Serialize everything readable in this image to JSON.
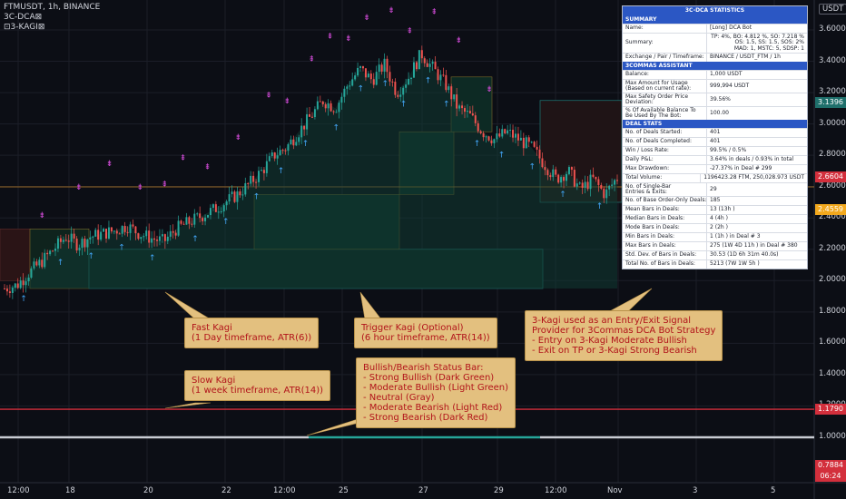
{
  "header": {
    "symbol_line": "FTMUSDT, 1h, BINANCE",
    "indicator1": "3C-DCA⊠",
    "indicator2": "⊡3-KAGI⊠",
    "currency": "USDT"
  },
  "stats_table": {
    "title": "3C-DCA  STATISTICS",
    "sections": [
      {
        "name": "SUMMARY",
        "rows": [
          {
            "k": "Name:",
            "v": "[Long] DCA Bot"
          },
          {
            "k": "Summary:",
            "v": "TP: 4%, BO: 4.812 %, SO: 7.218 %\nOS: 1.5, SS: 1.5, SOS: 2%\nMAD: 1, MSTC: 5, SDSP: 1",
            "right": true
          },
          {
            "k": "Exchange / Pair / Timeframe:",
            "v": "BINANCE / USDT_FTM / 1h"
          }
        ]
      },
      {
        "name": "3COMMAS ASSISTANT",
        "rows": [
          {
            "k": "Balance:",
            "v": "1,000 USDT"
          },
          {
            "k": "Max Amount for Usage\n(Based on current rate):",
            "v": "999,994 USDT"
          },
          {
            "k": "Max Safety Order Price\nDeviation:",
            "v": "39.56%"
          },
          {
            "k": "% Of Available Balance To\nBe Used By The Bot:",
            "v": "100.00"
          }
        ]
      },
      {
        "name": "DEAL STATS",
        "rows": [
          {
            "k": "No. of Deals Started:",
            "v": "401"
          },
          {
            "k": "No. of Deals Completed:",
            "v": "401"
          },
          {
            "k": "Win / Loss Rate:",
            "v": "99.5% / 0.5%"
          },
          {
            "k": "Daily P&L:",
            "v": "3.64% in deals / 0.93% in total"
          },
          {
            "k": "Max Drawdown:",
            "v": "-27.37% in Deal # 299"
          },
          {
            "k": "Total Volume:",
            "v": "1196423.28 FTM, 250,028.973 USDT"
          },
          {
            "k": "No. of Single-Bar\nEntries & Exits:",
            "v": "29"
          },
          {
            "k": "No. of Base Order-Only Deals:",
            "v": "185"
          },
          {
            "k": "Mean Bars in Deals:",
            "v": "13 (13h )"
          },
          {
            "k": "Median Bars in Deals:",
            "v": "4 (4h )"
          },
          {
            "k": "Mode Bars in Deals:",
            "v": "2 (2h )"
          },
          {
            "k": "Min Bars in Deals:",
            "v": "1 (1h ) in Deal # 3"
          },
          {
            "k": "Max Bars in Deals:",
            "v": "275 (1W 4D 11h ) in Deal # 380"
          },
          {
            "k": "Std. Dev. of Bars in Deals:",
            "v": "30.53 (1D 6h 31m 40.0s)"
          },
          {
            "k": "Total No. of Bars in Deals:",
            "v": "5213 (7W 1W 5h )"
          }
        ]
      }
    ]
  },
  "callouts": {
    "fast": "Fast Kagi\n(1 Day timeframe, ATR(6))",
    "trigger": "Trigger Kagi (Optional)\n(6 hour timeframe, ATR(14))",
    "strategy": "3-Kagi used as an Entry/Exit Signal\nProvider for 3Commas DCA Bot Strategy\n- Entry on 3-Kagi Moderate Bullish\n- Exit on TP or 3-Kagi Strong Bearish",
    "slow": "Slow Kagi\n(1 week timeframe, ATR(14))",
    "status": "Bullish/Bearish Status Bar:\n- Strong Bullish (Dark Green)\n- Moderate Bullish (Light Green)\n- Neutral (Gray)\n- Moderate Bearish (Light Red)\n- Strong Bearish (Dark Red)"
  },
  "price_tags": [
    {
      "label": "3.1396",
      "color": "#1f6f6b",
      "value": 3.1396
    },
    {
      "label": "2.6604",
      "color": "#d32f3c",
      "value": 2.6604
    },
    {
      "label": "2.4559",
      "color": "#f2a81d",
      "value": 2.4559
    },
    {
      "label": "1.1790",
      "color": "#d32f3c",
      "value": 1.179
    },
    {
      "label": "0.7884",
      "color": "#d32f3c",
      "value": 0.7884
    }
  ],
  "bottom_time": "06:24",
  "chart_data": {
    "type": "candlestick",
    "title": "FTMUSDT, 1h, BINANCE",
    "yaxis": {
      "ticks": [
        "3.6000",
        "3.4000",
        "3.2000",
        "3.0000",
        "2.8000",
        "2.6000",
        "2.4000",
        "2.2000",
        "2.0000",
        "1.8000",
        "1.6000",
        "1.4000",
        "1.2000",
        "1.0000"
      ],
      "ylim": [
        0.8,
        3.7
      ]
    },
    "xaxis": {
      "ticks": [
        "12:00",
        "18",
        "20",
        "22",
        "12:00",
        "25",
        "27",
        "29",
        "12:00",
        "Nov",
        "3",
        "5"
      ]
    },
    "close_path": [
      [
        0,
        1.95
      ],
      [
        0.02,
        1.97
      ],
      [
        0.04,
        2.05
      ],
      [
        0.06,
        2.12
      ],
      [
        0.08,
        2.2
      ],
      [
        0.1,
        2.28
      ],
      [
        0.12,
        2.23
      ],
      [
        0.14,
        2.28
      ],
      [
        0.16,
        2.3
      ],
      [
        0.18,
        2.32
      ],
      [
        0.2,
        2.35
      ],
      [
        0.22,
        2.3
      ],
      [
        0.24,
        2.27
      ],
      [
        0.26,
        2.25
      ],
      [
        0.28,
        2.33
      ],
      [
        0.3,
        2.37
      ],
      [
        0.32,
        2.41
      ],
      [
        0.34,
        2.45
      ],
      [
        0.36,
        2.5
      ],
      [
        0.38,
        2.55
      ],
      [
        0.4,
        2.62
      ],
      [
        0.42,
        2.7
      ],
      [
        0.44,
        2.8
      ],
      [
        0.46,
        2.85
      ],
      [
        0.48,
        2.95
      ],
      [
        0.5,
        3.05
      ],
      [
        0.52,
        3.15
      ],
      [
        0.54,
        3.1
      ],
      [
        0.56,
        3.25
      ],
      [
        0.58,
        3.35
      ],
      [
        0.6,
        3.28
      ],
      [
        0.62,
        3.38
      ],
      [
        0.64,
        3.2
      ],
      [
        0.66,
        3.3
      ],
      [
        0.68,
        3.45
      ],
      [
        0.7,
        3.35
      ],
      [
        0.72,
        3.25
      ],
      [
        0.74,
        3.1
      ],
      [
        0.76,
        3.05
      ],
      [
        0.78,
        2.95
      ],
      [
        0.8,
        2.9
      ],
      [
        0.82,
        2.95
      ],
      [
        0.84,
        2.9
      ],
      [
        0.86,
        2.85
      ],
      [
        0.88,
        2.75
      ],
      [
        0.9,
        2.65
      ],
      [
        0.92,
        2.7
      ],
      [
        0.94,
        2.58
      ],
      [
        0.96,
        2.65
      ],
      [
        0.98,
        2.55
      ],
      [
        1.0,
        2.66
      ]
    ],
    "status_bar_value": 1.0,
    "horizontal_line_value": 1.179
  }
}
